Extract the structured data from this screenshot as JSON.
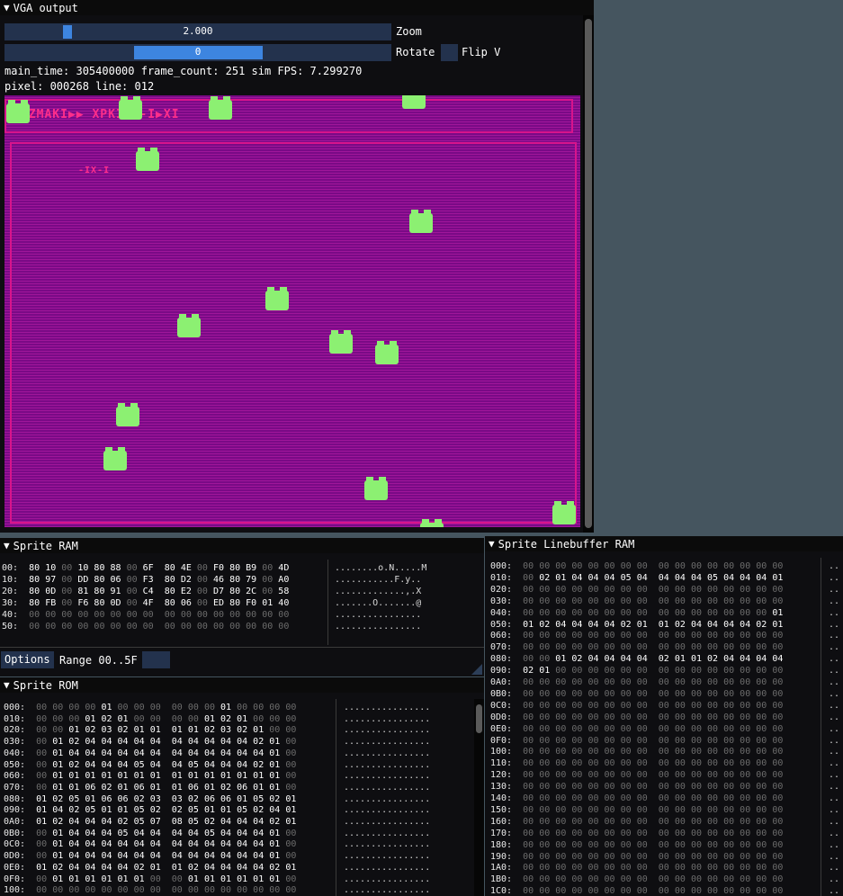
{
  "vga_window": {
    "title": "VGA output",
    "zoom_value": "2.000",
    "zoom_label": "Zoom",
    "zoom_fraction": 0.154,
    "rotate_value": "0",
    "rotate_label": "Rotate",
    "flipv_label": "Flip V",
    "status_line1": "main_time: 305400000 frame_count: 251 sim FPS: 7.299270",
    "status_line2": "pixel: 000268 line: 012",
    "hud_top": "WZMAKI▶▶  XPKIP▶-I▶XI",
    "hud_small": "-IX-I",
    "colors": {
      "background": "#7a0a86",
      "frame": "#d8148c",
      "sprite": "#8cf072"
    }
  },
  "sprite_ram": {
    "title": "Sprite RAM",
    "rows": [
      {
        "addr": "00:",
        "bytes": [
          "80",
          "10",
          "00",
          "10",
          "80",
          "88",
          "00",
          "6F",
          "80",
          "4E",
          "00",
          "F0",
          "80",
          "B9",
          "00",
          "4D"
        ],
        "ascii": "........o.N.....M"
      },
      {
        "addr": "10:",
        "bytes": [
          "80",
          "97",
          "00",
          "DD",
          "80",
          "06",
          "00",
          "F3",
          "80",
          "D2",
          "00",
          "46",
          "80",
          "79",
          "00",
          "A0"
        ],
        "ascii": "...........F.y.."
      },
      {
        "addr": "20:",
        "bytes": [
          "80",
          "0D",
          "00",
          "81",
          "80",
          "91",
          "00",
          "C4",
          "80",
          "E2",
          "00",
          "D7",
          "80",
          "2C",
          "00",
          "58"
        ],
        "ascii": ".............,.X"
      },
      {
        "addr": "30:",
        "bytes": [
          "80",
          "FB",
          "00",
          "F6",
          "80",
          "0D",
          "00",
          "4F",
          "80",
          "06",
          "00",
          "ED",
          "80",
          "F0",
          "01",
          "40"
        ],
        "ascii": ".......O.......@"
      },
      {
        "addr": "40:",
        "bytes": [
          "00",
          "00",
          "00",
          "00",
          "00",
          "00",
          "00",
          "00",
          "00",
          "00",
          "00",
          "00",
          "00",
          "00",
          "00",
          "00"
        ],
        "ascii": "................"
      },
      {
        "addr": "50:",
        "bytes": [
          "00",
          "00",
          "00",
          "00",
          "00",
          "00",
          "00",
          "00",
          "00",
          "00",
          "00",
          "00",
          "00",
          "00",
          "00",
          "00"
        ],
        "ascii": "................"
      }
    ],
    "options_label": "Options",
    "range_label": "Range 00..5F"
  },
  "sprite_rom": {
    "title": "Sprite ROM",
    "rows": [
      {
        "addr": "000:",
        "bytes": [
          "00",
          "00",
          "00",
          "00",
          "01",
          "00",
          "00",
          "00",
          "00",
          "00",
          "00",
          "01",
          "00",
          "00",
          "00",
          "00"
        ]
      },
      {
        "addr": "010:",
        "bytes": [
          "00",
          "00",
          "00",
          "01",
          "02",
          "01",
          "00",
          "00",
          "00",
          "00",
          "01",
          "02",
          "01",
          "00",
          "00",
          "00"
        ]
      },
      {
        "addr": "020:",
        "bytes": [
          "00",
          "00",
          "01",
          "02",
          "03",
          "02",
          "01",
          "01",
          "01",
          "01",
          "02",
          "03",
          "02",
          "01",
          "00",
          "00"
        ]
      },
      {
        "addr": "030:",
        "bytes": [
          "00",
          "01",
          "02",
          "04",
          "04",
          "04",
          "04",
          "04",
          "04",
          "04",
          "04",
          "04",
          "04",
          "02",
          "01",
          "00"
        ]
      },
      {
        "addr": "040:",
        "bytes": [
          "00",
          "01",
          "04",
          "04",
          "04",
          "04",
          "04",
          "04",
          "04",
          "04",
          "04",
          "04",
          "04",
          "04",
          "01",
          "00"
        ]
      },
      {
        "addr": "050:",
        "bytes": [
          "00",
          "01",
          "02",
          "04",
          "04",
          "04",
          "05",
          "04",
          "04",
          "05",
          "04",
          "04",
          "04",
          "02",
          "01",
          "00"
        ]
      },
      {
        "addr": "060:",
        "bytes": [
          "00",
          "01",
          "01",
          "01",
          "01",
          "01",
          "01",
          "01",
          "01",
          "01",
          "01",
          "01",
          "01",
          "01",
          "01",
          "00"
        ]
      },
      {
        "addr": "070:",
        "bytes": [
          "00",
          "01",
          "01",
          "06",
          "02",
          "01",
          "06",
          "01",
          "01",
          "06",
          "01",
          "02",
          "06",
          "01",
          "01",
          "00"
        ]
      },
      {
        "addr": "080:",
        "bytes": [
          "01",
          "02",
          "05",
          "01",
          "06",
          "06",
          "02",
          "03",
          "03",
          "02",
          "06",
          "06",
          "01",
          "05",
          "02",
          "01"
        ]
      },
      {
        "addr": "090:",
        "bytes": [
          "01",
          "04",
          "02",
          "05",
          "01",
          "01",
          "05",
          "02",
          "02",
          "05",
          "01",
          "01",
          "05",
          "02",
          "04",
          "01"
        ]
      },
      {
        "addr": "0A0:",
        "bytes": [
          "01",
          "02",
          "04",
          "04",
          "04",
          "02",
          "05",
          "07",
          "08",
          "05",
          "02",
          "04",
          "04",
          "04",
          "02",
          "01"
        ]
      },
      {
        "addr": "0B0:",
        "bytes": [
          "00",
          "01",
          "04",
          "04",
          "04",
          "05",
          "04",
          "04",
          "04",
          "04",
          "05",
          "04",
          "04",
          "04",
          "01",
          "00"
        ]
      },
      {
        "addr": "0C0:",
        "bytes": [
          "00",
          "01",
          "04",
          "04",
          "04",
          "04",
          "04",
          "04",
          "04",
          "04",
          "04",
          "04",
          "04",
          "04",
          "01",
          "00"
        ]
      },
      {
        "addr": "0D0:",
        "bytes": [
          "00",
          "01",
          "04",
          "04",
          "04",
          "04",
          "04",
          "04",
          "04",
          "04",
          "04",
          "04",
          "04",
          "04",
          "01",
          "00"
        ]
      },
      {
        "addr": "0E0:",
        "bytes": [
          "01",
          "02",
          "04",
          "04",
          "04",
          "04",
          "02",
          "01",
          "01",
          "02",
          "04",
          "04",
          "04",
          "04",
          "02",
          "01"
        ]
      },
      {
        "addr": "0F0:",
        "bytes": [
          "00",
          "01",
          "01",
          "01",
          "01",
          "01",
          "01",
          "00",
          "00",
          "01",
          "01",
          "01",
          "01",
          "01",
          "01",
          "00"
        ]
      },
      {
        "addr": "100:",
        "bytes": [
          "00",
          "00",
          "00",
          "00",
          "00",
          "00",
          "00",
          "00",
          "00",
          "00",
          "00",
          "00",
          "00",
          "00",
          "00",
          "00"
        ]
      }
    ],
    "ascii": "................"
  },
  "linebuffer": {
    "title": "Sprite Linebuffer RAM",
    "rows": [
      {
        "addr": "000:",
        "bytes": [
          "00",
          "00",
          "00",
          "00",
          "00",
          "00",
          "00",
          "00",
          "00",
          "00",
          "00",
          "00",
          "00",
          "00",
          "00",
          "00"
        ]
      },
      {
        "addr": "010:",
        "bytes": [
          "00",
          "02",
          "01",
          "04",
          "04",
          "04",
          "05",
          "04",
          "04",
          "04",
          "04",
          "05",
          "04",
          "04",
          "04",
          "01"
        ]
      },
      {
        "addr": "020:",
        "bytes": [
          "00",
          "00",
          "00",
          "00",
          "00",
          "00",
          "00",
          "00",
          "00",
          "00",
          "00",
          "00",
          "00",
          "00",
          "00",
          "00"
        ]
      },
      {
        "addr": "030:",
        "bytes": [
          "00",
          "00",
          "00",
          "00",
          "00",
          "00",
          "00",
          "00",
          "00",
          "00",
          "00",
          "00",
          "00",
          "00",
          "00",
          "00"
        ]
      },
      {
        "addr": "040:",
        "bytes": [
          "00",
          "00",
          "00",
          "00",
          "00",
          "00",
          "00",
          "00",
          "00",
          "00",
          "00",
          "00",
          "00",
          "00",
          "00",
          "01"
        ]
      },
      {
        "addr": "050:",
        "bytes": [
          "01",
          "02",
          "04",
          "04",
          "04",
          "04",
          "02",
          "01",
          "01",
          "02",
          "04",
          "04",
          "04",
          "04",
          "02",
          "01"
        ]
      },
      {
        "addr": "060:",
        "bytes": [
          "00",
          "00",
          "00",
          "00",
          "00",
          "00",
          "00",
          "00",
          "00",
          "00",
          "00",
          "00",
          "00",
          "00",
          "00",
          "00"
        ]
      },
      {
        "addr": "070:",
        "bytes": [
          "00",
          "00",
          "00",
          "00",
          "00",
          "00",
          "00",
          "00",
          "00",
          "00",
          "00",
          "00",
          "00",
          "00",
          "00",
          "00"
        ]
      },
      {
        "addr": "080:",
        "bytes": [
          "00",
          "00",
          "01",
          "02",
          "04",
          "04",
          "04",
          "04",
          "02",
          "01",
          "01",
          "02",
          "04",
          "04",
          "04",
          "04"
        ]
      },
      {
        "addr": "090:",
        "bytes": [
          "02",
          "01",
          "00",
          "00",
          "00",
          "00",
          "00",
          "00",
          "00",
          "00",
          "00",
          "00",
          "00",
          "00",
          "00",
          "00"
        ]
      },
      {
        "addr": "0A0:",
        "bytes": [
          "00",
          "00",
          "00",
          "00",
          "00",
          "00",
          "00",
          "00",
          "00",
          "00",
          "00",
          "00",
          "00",
          "00",
          "00",
          "00"
        ]
      },
      {
        "addr": "0B0:",
        "bytes": [
          "00",
          "00",
          "00",
          "00",
          "00",
          "00",
          "00",
          "00",
          "00",
          "00",
          "00",
          "00",
          "00",
          "00",
          "00",
          "00"
        ]
      },
      {
        "addr": "0C0:",
        "bytes": [
          "00",
          "00",
          "00",
          "00",
          "00",
          "00",
          "00",
          "00",
          "00",
          "00",
          "00",
          "00",
          "00",
          "00",
          "00",
          "00"
        ]
      },
      {
        "addr": "0D0:",
        "bytes": [
          "00",
          "00",
          "00",
          "00",
          "00",
          "00",
          "00",
          "00",
          "00",
          "00",
          "00",
          "00",
          "00",
          "00",
          "00",
          "00"
        ]
      },
      {
        "addr": "0E0:",
        "bytes": [
          "00",
          "00",
          "00",
          "00",
          "00",
          "00",
          "00",
          "00",
          "00",
          "00",
          "00",
          "00",
          "00",
          "00",
          "00",
          "00"
        ]
      },
      {
        "addr": "0F0:",
        "bytes": [
          "00",
          "00",
          "00",
          "00",
          "00",
          "00",
          "00",
          "00",
          "00",
          "00",
          "00",
          "00",
          "00",
          "00",
          "00",
          "00"
        ]
      },
      {
        "addr": "100:",
        "bytes": [
          "00",
          "00",
          "00",
          "00",
          "00",
          "00",
          "00",
          "00",
          "00",
          "00",
          "00",
          "00",
          "00",
          "00",
          "00",
          "00"
        ]
      },
      {
        "addr": "110:",
        "bytes": [
          "00",
          "00",
          "00",
          "00",
          "00",
          "00",
          "00",
          "00",
          "00",
          "00",
          "00",
          "00",
          "00",
          "00",
          "00",
          "00"
        ]
      },
      {
        "addr": "120:",
        "bytes": [
          "00",
          "00",
          "00",
          "00",
          "00",
          "00",
          "00",
          "00",
          "00",
          "00",
          "00",
          "00",
          "00",
          "00",
          "00",
          "00"
        ]
      },
      {
        "addr": "130:",
        "bytes": [
          "00",
          "00",
          "00",
          "00",
          "00",
          "00",
          "00",
          "00",
          "00",
          "00",
          "00",
          "00",
          "00",
          "00",
          "00",
          "00"
        ]
      },
      {
        "addr": "140:",
        "bytes": [
          "00",
          "00",
          "00",
          "00",
          "00",
          "00",
          "00",
          "00",
          "00",
          "00",
          "00",
          "00",
          "00",
          "00",
          "00",
          "00"
        ]
      },
      {
        "addr": "150:",
        "bytes": [
          "00",
          "00",
          "00",
          "00",
          "00",
          "00",
          "00",
          "00",
          "00",
          "00",
          "00",
          "00",
          "00",
          "00",
          "00",
          "00"
        ]
      },
      {
        "addr": "160:",
        "bytes": [
          "00",
          "00",
          "00",
          "00",
          "00",
          "00",
          "00",
          "00",
          "00",
          "00",
          "00",
          "00",
          "00",
          "00",
          "00",
          "00"
        ]
      },
      {
        "addr": "170:",
        "bytes": [
          "00",
          "00",
          "00",
          "00",
          "00",
          "00",
          "00",
          "00",
          "00",
          "00",
          "00",
          "00",
          "00",
          "00",
          "00",
          "00"
        ]
      },
      {
        "addr": "180:",
        "bytes": [
          "00",
          "00",
          "00",
          "00",
          "00",
          "00",
          "00",
          "00",
          "00",
          "00",
          "00",
          "00",
          "00",
          "00",
          "00",
          "00"
        ]
      },
      {
        "addr": "190:",
        "bytes": [
          "00",
          "00",
          "00",
          "00",
          "00",
          "00",
          "00",
          "00",
          "00",
          "00",
          "00",
          "00",
          "00",
          "00",
          "00",
          "00"
        ]
      },
      {
        "addr": "1A0:",
        "bytes": [
          "00",
          "00",
          "00",
          "00",
          "00",
          "00",
          "00",
          "00",
          "00",
          "00",
          "00",
          "00",
          "00",
          "00",
          "00",
          "00"
        ]
      },
      {
        "addr": "1B0:",
        "bytes": [
          "00",
          "00",
          "00",
          "00",
          "00",
          "00",
          "00",
          "00",
          "00",
          "00",
          "00",
          "00",
          "00",
          "00",
          "00",
          "00"
        ]
      },
      {
        "addr": "1C0:",
        "bytes": [
          "00",
          "00",
          "00",
          "00",
          "00",
          "00",
          "00",
          "00",
          "00",
          "00",
          "00",
          "00",
          "00",
          "00",
          "00",
          "00"
        ]
      }
    ],
    "ascii": ".."
  }
}
